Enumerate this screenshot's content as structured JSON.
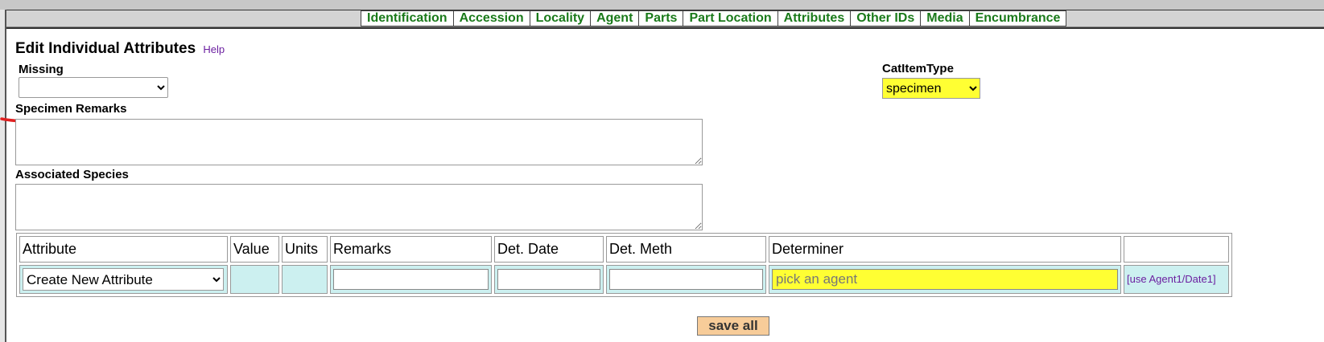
{
  "tabs": [
    "Identification",
    "Accession",
    "Locality",
    "Agent",
    "Parts",
    "Part Location",
    "Attributes",
    "Other IDs",
    "Media",
    "Encumbrance"
  ],
  "page": {
    "title": "Edit Individual Attributes",
    "help_label": "Help"
  },
  "missing": {
    "label": "Missing",
    "selected": ""
  },
  "catitemtype": {
    "label": "CatItemType",
    "selected": "specimen"
  },
  "specimen_remarks": {
    "label": "Specimen Remarks",
    "value": ""
  },
  "associated_species": {
    "label": "Associated Species",
    "value": ""
  },
  "attributes_table": {
    "headers": [
      "Attribute",
      "Value",
      "Units",
      "Remarks",
      "Det. Date",
      "Det. Meth",
      "Determiner",
      ""
    ],
    "new_row": {
      "attribute_selected": "Create New Attribute",
      "determiner_placeholder": "pick an agent",
      "use_agent_link": "[use Agent1/Date1]"
    }
  },
  "save_label": "save all",
  "colors": {
    "tab_text": "#1a7a1a",
    "highlight": "#ffff33",
    "link": "#6b1fa0",
    "save_button": "#f7cc99",
    "input_tint": "#ccf0f0",
    "annotation": "#e02020"
  }
}
